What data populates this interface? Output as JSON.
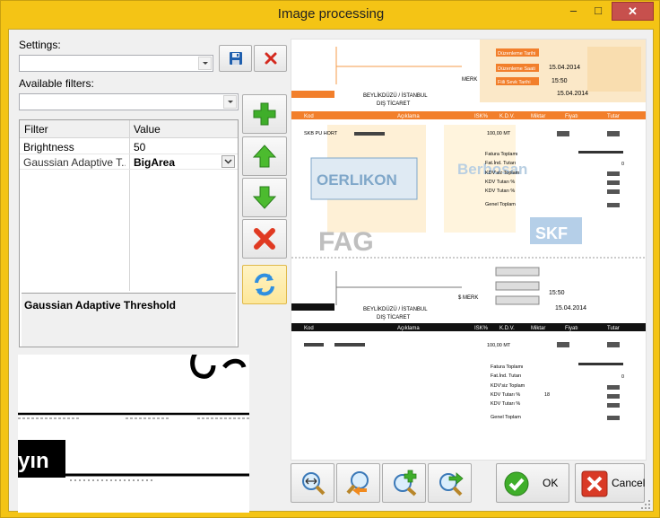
{
  "window": {
    "title": "Image processing",
    "minimize": "–",
    "maximize": "□",
    "close": "✕"
  },
  "settings": {
    "label": "Settings:",
    "value": "",
    "save_icon": "floppy-disk-icon",
    "delete_icon": "red-x-icon"
  },
  "filters": {
    "label": "Available filters:",
    "value": "",
    "columns": [
      "Filter",
      "Value"
    ],
    "rows": [
      {
        "name": "Brightness",
        "value": "50"
      },
      {
        "name": "Gaussian Adaptive Threshold",
        "display_name": "Gaussian Adaptive T...",
        "value": "BigArea"
      }
    ],
    "description": "Gaussian Adaptive Threshold"
  },
  "side_buttons": [
    "add-icon",
    "move-up-icon",
    "move-down-icon",
    "remove-icon",
    "refresh-icon"
  ],
  "preview_snippet": "yın",
  "document": {
    "header_city": "BEYLİKDÜZÜ / İSTANBUL",
    "header_office": "DIŞ TİCARET",
    "header_merk": "MERK",
    "header_sm": "$ MERK",
    "date_label_1": "Düzenleme Tarihi",
    "date_label_2": "Düzenleme Saati",
    "date_label_3": "Fiili Sevk Tarihi",
    "date_value": "15.04.2014",
    "time_value": "15:50",
    "columns": [
      "Kod",
      "Açıklama",
      "ISK%",
      "K.D.V.",
      "Miktar",
      "Fiyatı",
      "Tutar"
    ],
    "item_code": "SKB PU HORT",
    "item_qty": "100,00 MT",
    "totals": [
      "Fatura Toplamı",
      "Fat.İnd. Tutarı",
      "KDV'siz Toplam",
      "KDV Tutarı %",
      "KDV Tutarı %",
      "Genel Toplam"
    ],
    "kdv_rate": "18",
    "zero": "0",
    "brands": [
      "OERLIKON",
      "FAG",
      "SKF",
      "Berbosan"
    ]
  },
  "toolbar": [
    "fit-width-icon",
    "zoom-out-icon",
    "zoom-in-icon",
    "zoom-actual-icon"
  ],
  "ok_label": "OK",
  "cancel_label": "Cancel"
}
